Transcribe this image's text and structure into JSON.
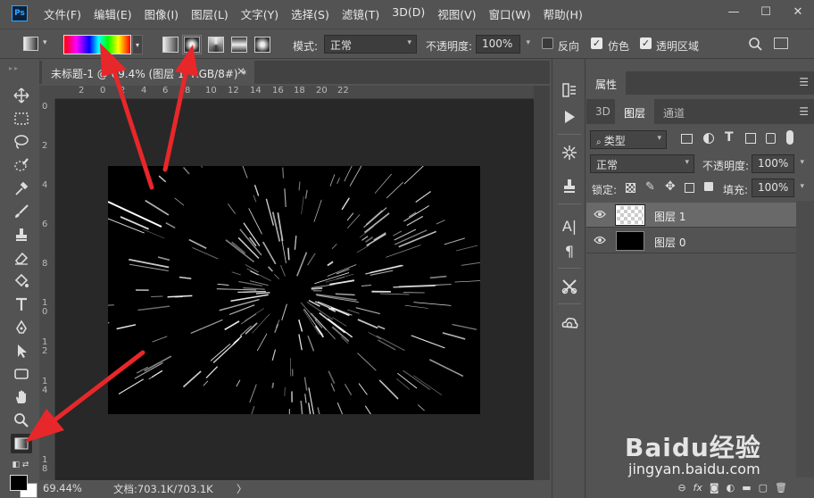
{
  "app": {
    "logo": "Ps"
  },
  "menu": [
    "文件(F)",
    "编辑(E)",
    "图像(I)",
    "图层(L)",
    "文字(Y)",
    "选择(S)",
    "滤镜(T)",
    "3D(D)",
    "视图(V)",
    "窗口(W)",
    "帮助(H)"
  ],
  "window_controls": {
    "minimize": "—",
    "maximize": "☐",
    "close": "✕"
  },
  "options": {
    "mode_label": "模式:",
    "mode_value": "正常",
    "opacity_label": "不透明度:",
    "opacity_value": "100%",
    "reverse_label": "反向",
    "reverse_checked": false,
    "dither_label": "仿色",
    "dither_checked": true,
    "transparency_label": "透明区域",
    "transparency_checked": true,
    "active_gradient_type": "radial"
  },
  "document": {
    "tab_title": "未标题-1 @ 69.4% (图层 1, RGB/8#) *",
    "tab_close": "✕",
    "ruler_top": [
      "2",
      "0",
      "2",
      "4",
      "6",
      "8",
      "10",
      "12",
      "14",
      "16",
      "18",
      "20",
      "22"
    ],
    "ruler_left": [
      "0",
      "2",
      "4",
      "6",
      "8",
      "1 0",
      "1 2",
      "1 4",
      "1 6",
      "1 8"
    ],
    "zoom": "69.44%",
    "doc_info": "文档:703.1K/703.1K",
    "status_arrow": "〉"
  },
  "properties_panel": {
    "tab": "属性"
  },
  "layers_panel": {
    "tabs": [
      "3D",
      "图层",
      "通道"
    ],
    "active_tab": "图层",
    "filter_label": "类型",
    "blend_mode": "正常",
    "opacity_label": "不透明度:",
    "opacity_value": "100%",
    "lock_label": "锁定:",
    "fill_label": "填充:",
    "fill_value": "100%",
    "layers": [
      {
        "name": "图层 1",
        "selected": true,
        "thumb": "transparent"
      },
      {
        "name": "图层 0",
        "selected": false,
        "thumb": "starburst"
      }
    ]
  },
  "watermark": {
    "brand": "Baidu经验",
    "url": "jingyan.baidu.com"
  },
  "colors": {
    "ui_bg": "#535353",
    "panel_dark": "#424242",
    "arrow": "#e8272a",
    "accent": "#31a8ff"
  }
}
